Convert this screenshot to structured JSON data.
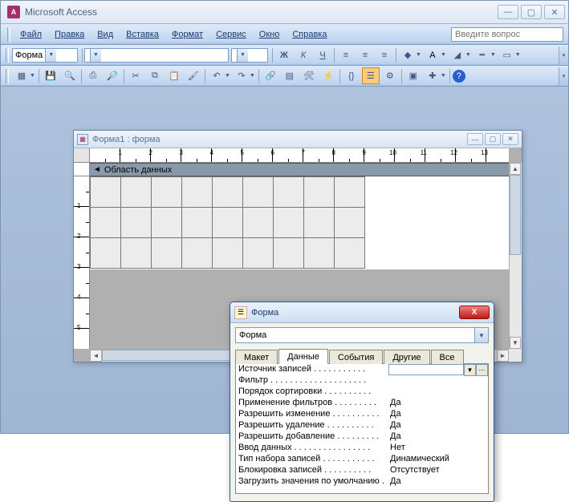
{
  "app": {
    "title": "Microsoft Access"
  },
  "menu": {
    "items": [
      "Файл",
      "Правка",
      "Вид",
      "Вставка",
      "Формат",
      "Сервис",
      "Окно",
      "Справка"
    ],
    "search_placeholder": "Введите вопрос"
  },
  "format_toolbar": {
    "object_combo": "Форма",
    "font_combo": "",
    "size_combo": "",
    "bold": "Ж",
    "italic": "К",
    "underline": "Ч"
  },
  "form_window": {
    "title": "Форма1 : форма",
    "section": "Область данных",
    "ruler_ticks": [
      "1",
      "2",
      "3",
      "4",
      "5",
      "6",
      "7",
      "8",
      "9",
      "10",
      "11",
      "12",
      "13"
    ],
    "vruler_ticks": [
      "1",
      "2",
      "3",
      "4",
      "5"
    ]
  },
  "props": {
    "title": "Форма",
    "combo": "Форма",
    "tabs": [
      "Макет",
      "Данные",
      "События",
      "Другие",
      "Все"
    ],
    "active_tab": 1,
    "rows": [
      {
        "label": "Источник записей . . . . . . . . . . .",
        "value": ""
      },
      {
        "label": "Фильтр . . . . . . . . . . . . . . . . . . . .",
        "value": ""
      },
      {
        "label": "Порядок сортировки . . . . . . . . . .",
        "value": ""
      },
      {
        "label": "Применение фильтров . . . . . . . . .",
        "value": "Да"
      },
      {
        "label": "Разрешить изменение . . . . . . . . . .",
        "value": "Да"
      },
      {
        "label": "Разрешить удаление . . . . . . . . . .",
        "value": "Да"
      },
      {
        "label": "Разрешить добавление . . . . . . . . .",
        "value": "Да"
      },
      {
        "label": "Ввод данных . . . . . . . . . . . . . . . .",
        "value": "Нет"
      },
      {
        "label": "Тип набора записей . . . . . . . . . . .",
        "value": "Динамический"
      },
      {
        "label": "Блокировка записей . . . . . . . . . .",
        "value": "Отсутствует"
      },
      {
        "label": "Загрузить значения по умолчанию .",
        "value": "Да"
      }
    ]
  }
}
